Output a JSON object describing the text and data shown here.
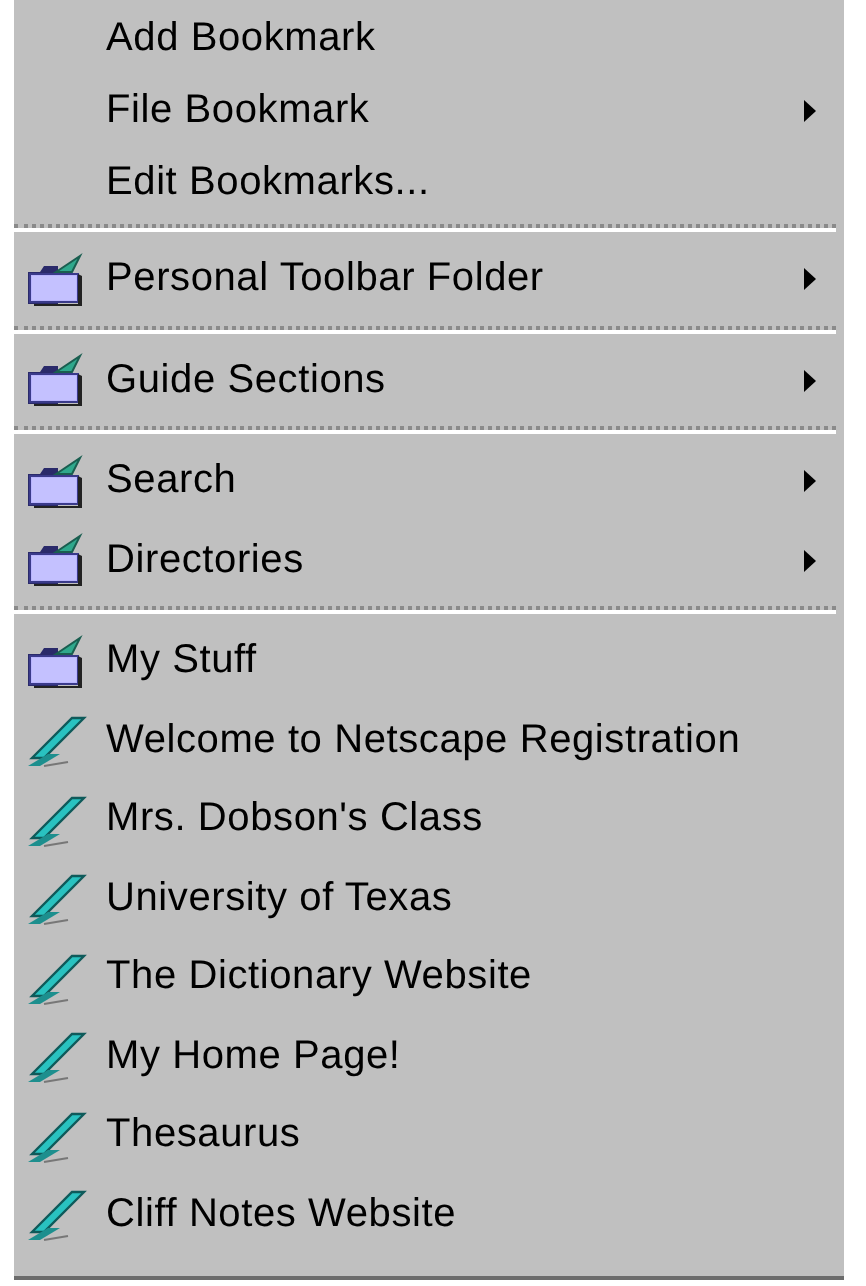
{
  "menu": {
    "sections": [
      {
        "items": [
          {
            "label": "Add Bookmark",
            "kind": "action",
            "submenu": false
          },
          {
            "label": "File Bookmark",
            "kind": "action",
            "submenu": true
          },
          {
            "label": "Edit Bookmarks...",
            "kind": "action",
            "submenu": false
          }
        ]
      },
      {
        "items": [
          {
            "label": "Personal Toolbar Folder",
            "kind": "folder",
            "submenu": true
          }
        ]
      },
      {
        "items": [
          {
            "label": "Guide Sections",
            "kind": "folder",
            "submenu": true
          }
        ]
      },
      {
        "items": [
          {
            "label": "Search",
            "kind": "folder",
            "submenu": true
          },
          {
            "label": "Directories",
            "kind": "folder",
            "submenu": true
          }
        ]
      },
      {
        "items": [
          {
            "label": "My Stuff",
            "kind": "folder",
            "submenu": false
          },
          {
            "label": "Welcome to Netscape Registration",
            "kind": "bookmark",
            "submenu": false
          },
          {
            "label": "Mrs. Dobson's Class",
            "kind": "bookmark",
            "submenu": false
          },
          {
            "label": "University of Texas",
            "kind": "bookmark",
            "submenu": false
          },
          {
            "label": "The Dictionary Website",
            "kind": "bookmark",
            "submenu": false
          },
          {
            "label": "My Home Page!",
            "kind": "bookmark",
            "submenu": false
          },
          {
            "label": "Thesaurus",
            "kind": "bookmark",
            "submenu": false
          },
          {
            "label": "Cliff Notes Website",
            "kind": "bookmark",
            "submenu": false
          }
        ]
      }
    ]
  }
}
